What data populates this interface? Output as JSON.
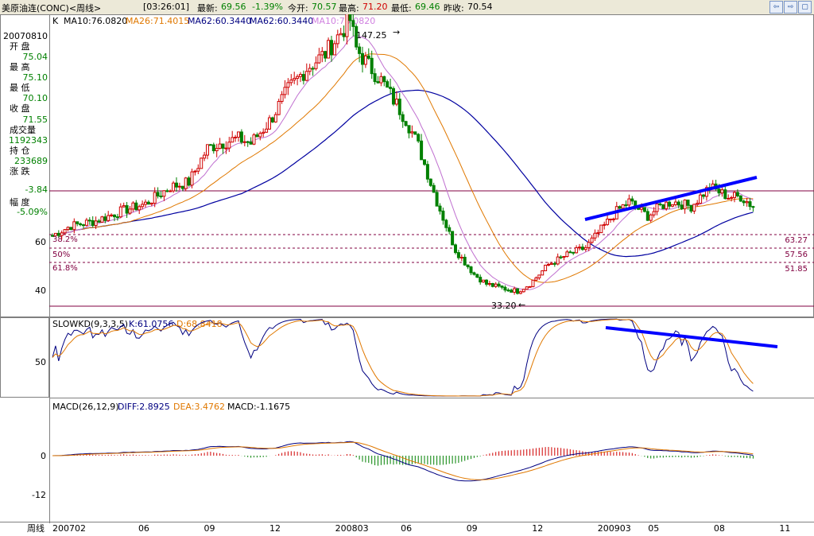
{
  "header": {
    "title": "美原油连(CONC)<周线>",
    "time": "[03:26:01]",
    "latest_label": "最新:",
    "latest": "69.56",
    "change": "-1.39%",
    "open_label": "今开:",
    "open": "70.57",
    "high_label": "最高:",
    "high": "71.20",
    "low_label": "最低:",
    "low": "69.46",
    "prev_label": "昨收:",
    "prev": "70.54",
    "buttons": [
      "⇦",
      "⇨",
      "▢"
    ]
  },
  "info_panel": {
    "date": "20070810",
    "open_label": "开 盘",
    "open": "75.04",
    "high_label": "最 高",
    "high": "75.10",
    "low_label": "最 低",
    "low": "70.10",
    "close_label": "收 盘",
    "close": "71.55",
    "volume_label": "成交量",
    "volume": "1192343",
    "oi_label": "持 仓",
    "oi": "233689",
    "chg_label": "涨 跌",
    "chg": "-3.84",
    "pct_label": "幅 度",
    "pct": "-5.09%"
  },
  "ma_legend": {
    "k": "K",
    "items": [
      {
        "text": "MA10:76.0820",
        "color": "#000000"
      },
      {
        "text": "MA26:71.4015",
        "color": "#e07800"
      },
      {
        "text": "MA62:60.3440",
        "color": "#000080"
      },
      {
        "text": "MA62:60.3440",
        "color": "#000080"
      },
      {
        "text": "MA10:76.0820",
        "color": "#d080e0"
      }
    ]
  },
  "kd_legend": {
    "name": "SLOWKD(9,3,3,5)",
    "k": "K:61.0756",
    "d": "D:68.8418"
  },
  "macd_legend": {
    "name": "MACD(26,12,9)",
    "diff": "DIFF:2.8925",
    "dea": "DEA:3.4762",
    "macd": "MACD:-1.1675"
  },
  "bottom_label": "周线",
  "colors": {
    "up": "#d00000",
    "down": "#008000",
    "ma_short": "#c070d0",
    "ma_mid": "#e07800",
    "ma_long": "#0000a0",
    "trend": "#0000ff",
    "fib": "#800040",
    "grid": "#800040"
  },
  "chart_data": {
    "type": "candlestick",
    "price_axis": {
      "ticks": [
        40,
        60
      ]
    },
    "x_ticks": [
      "200702",
      "06",
      "09",
      "12",
      "200803",
      "06",
      "09",
      "12",
      "200903",
      "05",
      "08",
      "11"
    ],
    "annotations": {
      "high": "147.25",
      "low": "33.20",
      "ret_38": "38.2%",
      "ret_50": "50%",
      "ret_618": "61.8%"
    },
    "fib_levels": [
      {
        "value": 63.27,
        "label": "63.27"
      },
      {
        "value": 57.56,
        "label": "57.56"
      },
      {
        "value": 51.85,
        "label": "51.85"
      }
    ],
    "kd_axis": {
      "ticks": [
        50
      ]
    },
    "macd_axis": {
      "ticks": [
        0,
        -12
      ]
    },
    "price_anchors": [
      [
        0,
        58
      ],
      [
        6,
        62
      ],
      [
        14,
        64
      ],
      [
        22,
        68
      ],
      [
        30,
        71
      ],
      [
        38,
        78
      ],
      [
        44,
        80
      ],
      [
        50,
        94
      ],
      [
        54,
        96
      ],
      [
        60,
        98
      ],
      [
        64,
        96
      ],
      [
        70,
        105
      ],
      [
        76,
        118
      ],
      [
        82,
        127
      ],
      [
        88,
        133
      ],
      [
        92,
        140
      ],
      [
        96,
        147
      ],
      [
        98,
        135
      ],
      [
        102,
        128
      ],
      [
        106,
        122
      ],
      [
        110,
        114
      ],
      [
        114,
        106
      ],
      [
        118,
        95
      ],
      [
        124,
        72
      ],
      [
        130,
        52
      ],
      [
        136,
        42
      ],
      [
        140,
        38
      ],
      [
        146,
        36
      ],
      [
        150,
        35
      ],
      [
        154,
        38
      ],
      [
        160,
        46
      ],
      [
        166,
        50
      ],
      [
        172,
        53
      ],
      [
        178,
        62
      ],
      [
        182,
        68
      ],
      [
        186,
        72
      ],
      [
        192,
        66
      ],
      [
        196,
        70
      ],
      [
        200,
        72
      ],
      [
        206,
        70
      ],
      [
        212,
        78
      ],
      [
        218,
        74
      ],
      [
        222,
        74
      ],
      [
        226,
        70
      ]
    ]
  }
}
